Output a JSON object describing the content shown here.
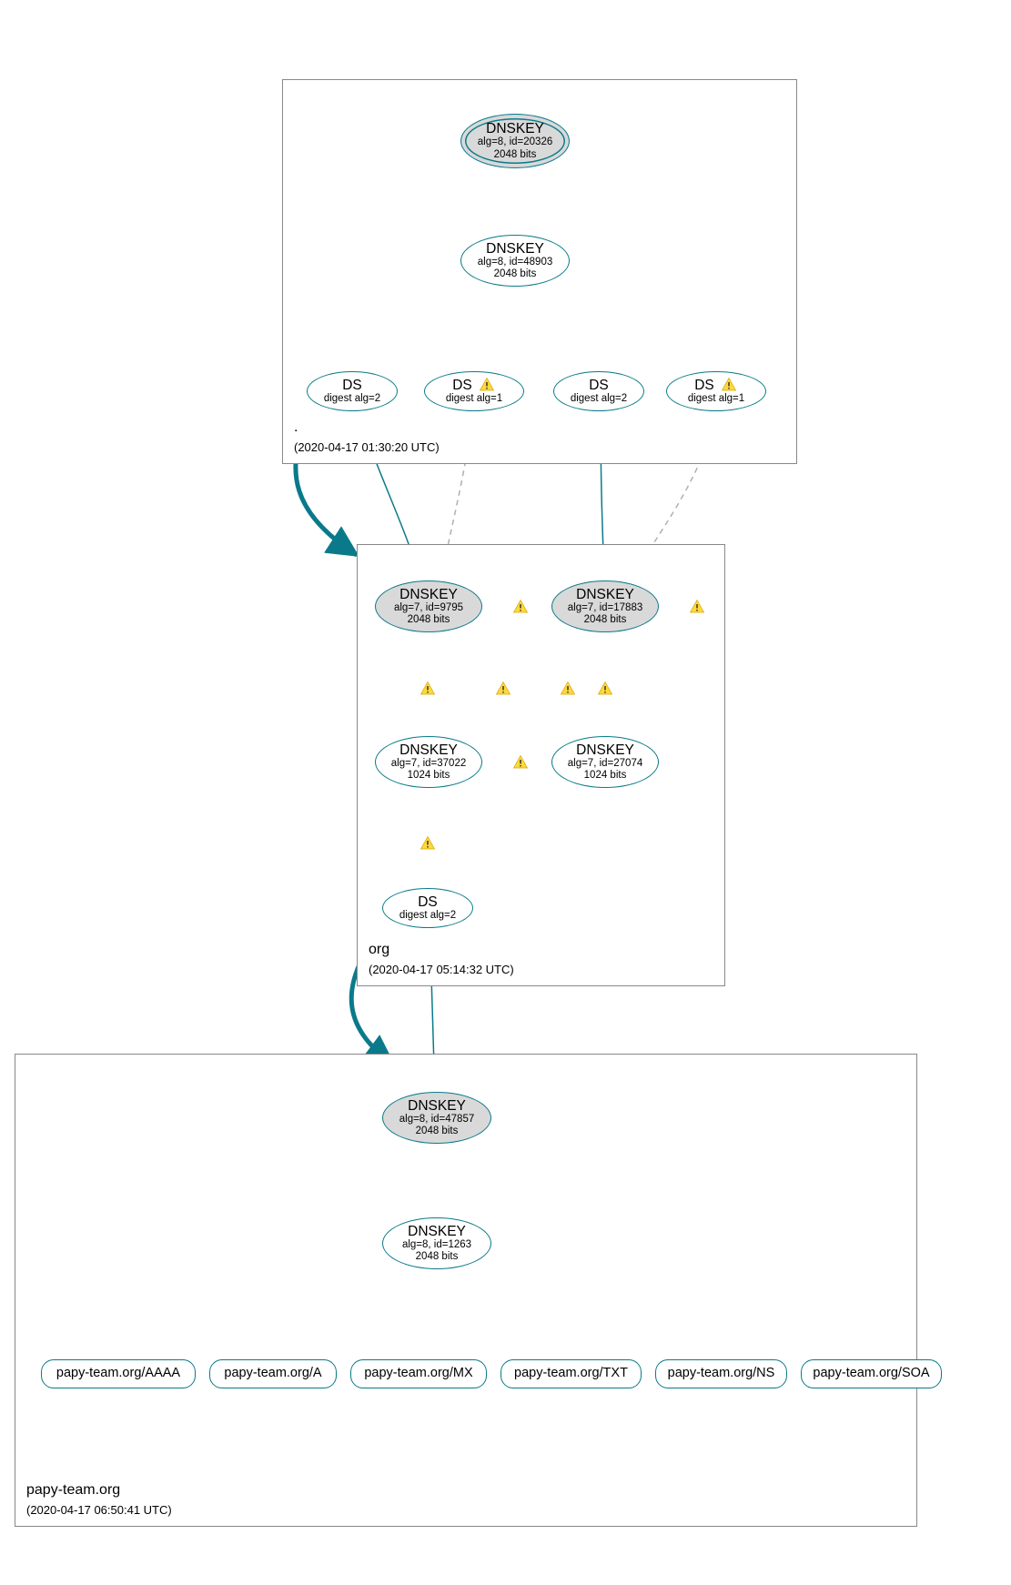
{
  "zones": {
    "root": {
      "name": ".",
      "timestamp": "(2020-04-17 01:30:20 UTC)"
    },
    "org": {
      "name": "org",
      "timestamp": "(2020-04-17 05:14:32 UTC)"
    },
    "domain": {
      "name": "papy-team.org",
      "timestamp": "(2020-04-17 06:50:41 UTC)"
    }
  },
  "nodes": {
    "root_ksk": {
      "title": "DNSKEY",
      "sub1": "alg=8, id=20326",
      "sub2": "2048 bits"
    },
    "root_zsk": {
      "title": "DNSKEY",
      "sub1": "alg=8, id=48903",
      "sub2": "2048 bits"
    },
    "root_ds1": {
      "title": "DS",
      "sub1": "digest alg=2"
    },
    "root_ds2": {
      "title": "DS",
      "sub1": "digest alg=1"
    },
    "root_ds3": {
      "title": "DS",
      "sub1": "digest alg=2"
    },
    "root_ds4": {
      "title": "DS",
      "sub1": "digest alg=1"
    },
    "org_ksk1": {
      "title": "DNSKEY",
      "sub1": "alg=7, id=9795",
      "sub2": "2048 bits"
    },
    "org_ksk2": {
      "title": "DNSKEY",
      "sub1": "alg=7, id=17883",
      "sub2": "2048 bits"
    },
    "org_zsk1": {
      "title": "DNSKEY",
      "sub1": "alg=7, id=37022",
      "sub2": "1024 bits"
    },
    "org_zsk2": {
      "title": "DNSKEY",
      "sub1": "alg=7, id=27074",
      "sub2": "1024 bits"
    },
    "org_ds": {
      "title": "DS",
      "sub1": "digest alg=2"
    },
    "dom_ksk": {
      "title": "DNSKEY",
      "sub1": "alg=8, id=47857",
      "sub2": "2048 bits"
    },
    "dom_zsk": {
      "title": "DNSKEY",
      "sub1": "alg=8, id=1263",
      "sub2": "2048 bits"
    },
    "rr_aaaa": {
      "label": "papy-team.org/AAAA"
    },
    "rr_a": {
      "label": "papy-team.org/A"
    },
    "rr_mx": {
      "label": "papy-team.org/MX"
    },
    "rr_txt": {
      "label": "papy-team.org/TXT"
    },
    "rr_ns": {
      "label": "papy-team.org/NS"
    },
    "rr_soa": {
      "label": "papy-team.org/SOA"
    }
  },
  "icons": {
    "warning": "warning-icon"
  }
}
